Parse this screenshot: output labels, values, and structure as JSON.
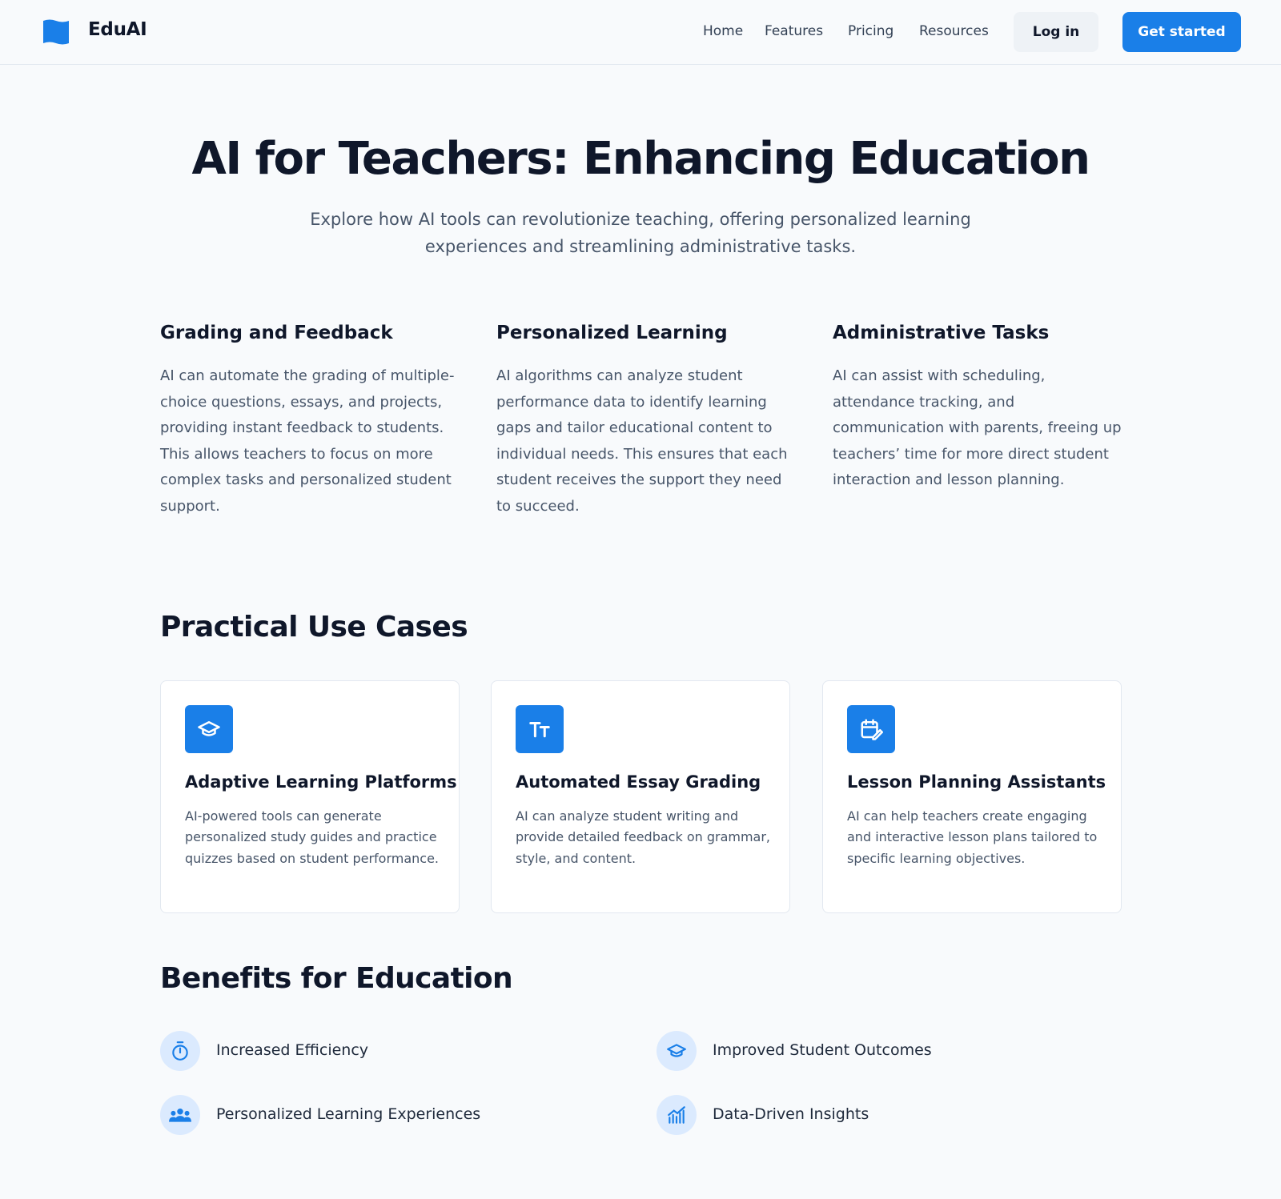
{
  "brand": {
    "name": "EduAI",
    "accent": "#1a7fe8"
  },
  "nav": {
    "links": [
      "Home",
      "Features",
      "Pricing",
      "Resources"
    ],
    "login": "Log in",
    "cta": "Get started"
  },
  "hero": {
    "title": "AI for Teachers: Enhancing Education",
    "subtitle": "Explore how AI tools can revolutionize teaching, offering personalized learning experiences and streamlining administrative tasks."
  },
  "features": [
    {
      "title": "Grading and Feedback",
      "text": "AI can automate the grading of multiple-choice questions, essays, and projects, providing instant feedback to students. This allows teachers to focus on more complex tasks and personalized student support."
    },
    {
      "title": "Personalized Learning",
      "text": "AI algorithms can analyze student performance data to identify learning gaps and tailor educational content to individual needs. This ensures that each student receives the support they need to succeed."
    },
    {
      "title": "Administrative Tasks",
      "text": "AI can assist with scheduling, attendance tracking, and communication with parents, freeing up teachers’ time for more direct student interaction and lesson planning."
    }
  ],
  "use_cases": {
    "heading": "Practical Use Cases",
    "cards": [
      {
        "icon": "graduation-cap-icon",
        "title": "Adaptive Learning Platforms",
        "text": "AI-powered tools can generate personalized study guides and practice quizzes based on student performance."
      },
      {
        "icon": "text-size-icon",
        "title": "Automated Essay Grading",
        "text": "AI can analyze student writing and provide detailed feedback on grammar, style, and content."
      },
      {
        "icon": "calendar-edit-icon",
        "title": "Lesson Planning Assistants",
        "text": "AI can help teachers create engaging and interactive lesson plans tailored to specific learning objectives."
      }
    ]
  },
  "benefits": {
    "heading": "Benefits for Education",
    "items": [
      {
        "icon": "timer-icon",
        "label": "Increased Efficiency"
      },
      {
        "icon": "graduation-cap-icon",
        "label": "Improved Student Outcomes"
      },
      {
        "icon": "group-icon",
        "label": "Personalized Learning Experiences"
      },
      {
        "icon": "chart-icon",
        "label": "Data-Driven Insights"
      }
    ]
  }
}
